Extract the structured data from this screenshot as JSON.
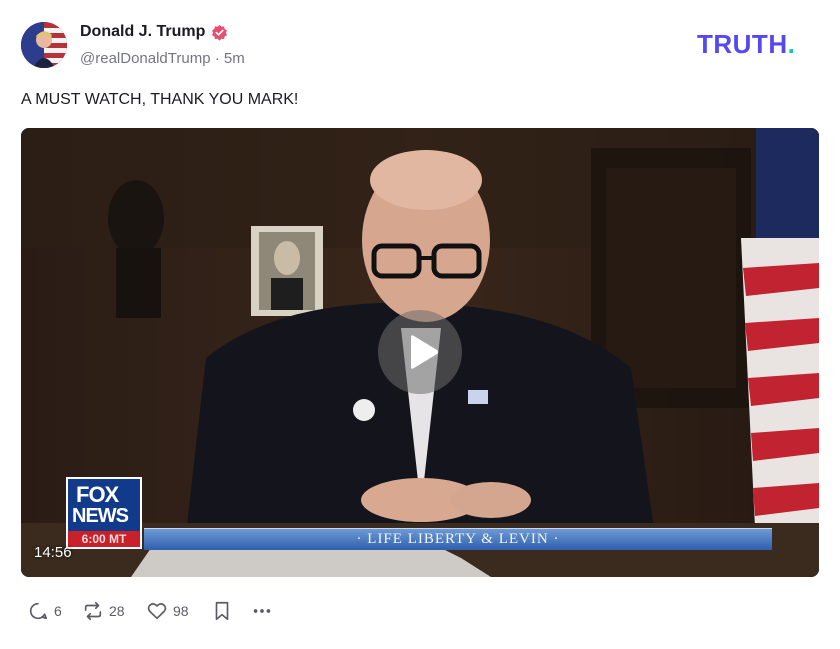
{
  "post": {
    "author_name": "Donald J. Trump",
    "handle": "@realDonaldTrump",
    "separator": "·",
    "timestamp": "5m",
    "text": "A MUST WATCH, THANK YOU MARK!"
  },
  "brand": {
    "logo_text": "TRUTH",
    "logo_dot": ".",
    "color": "#5448ee",
    "dot_color": "#0bc5c8"
  },
  "video": {
    "duration": "14:56",
    "overlay_network_line1": "FOX",
    "overlay_network_line2": "NEWS",
    "overlay_time": "6:00 MT",
    "overlay_show_title": "· LIFE LIBERTY & LEVIN ·",
    "play_icon": "play-icon"
  },
  "actions": {
    "replies": {
      "icon": "reply-icon",
      "count": "6"
    },
    "retruths": {
      "icon": "repost-icon",
      "count": "28"
    },
    "likes": {
      "icon": "heart-icon",
      "count": "98"
    },
    "bookmark": {
      "icon": "bookmark-icon"
    },
    "more": {
      "icon": "more-icon"
    }
  },
  "colors": {
    "verified_badge": "#e64f6e",
    "text_primary": "#1b1b22",
    "text_secondary": "#757580"
  }
}
